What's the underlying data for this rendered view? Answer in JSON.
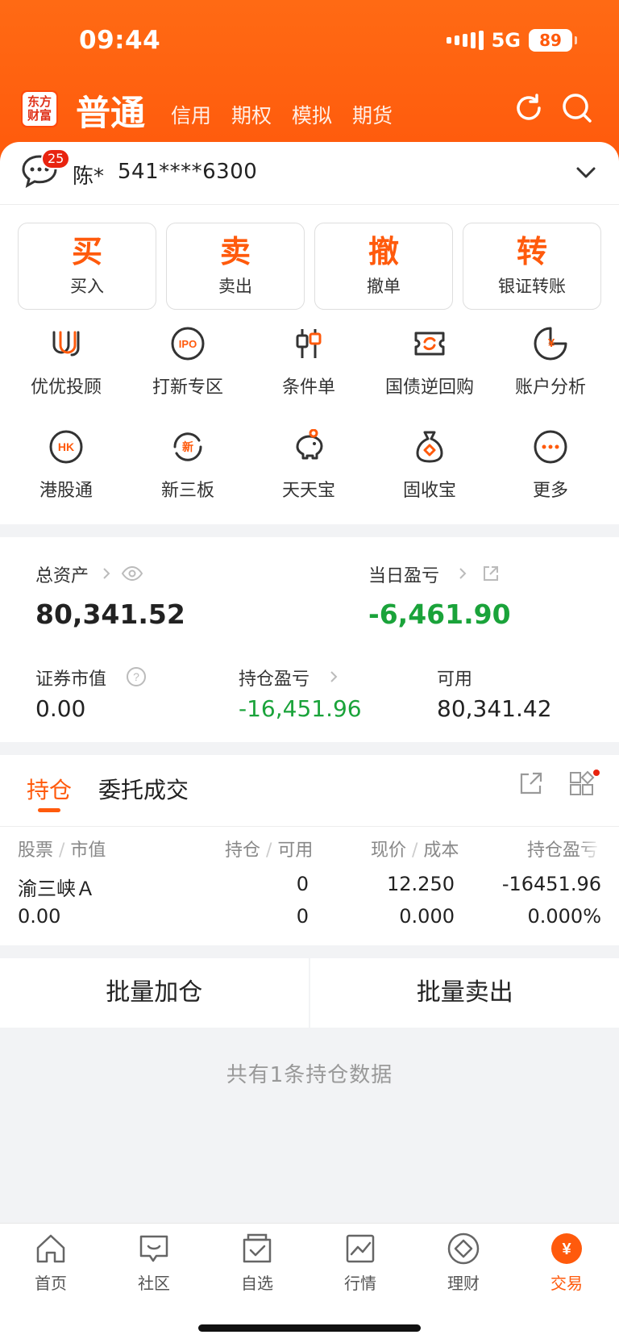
{
  "status": {
    "time": "09:44",
    "network": "5G",
    "battery": "89"
  },
  "header": {
    "logo": [
      "东方",
      "财富"
    ],
    "active_tab": "普通",
    "tabs": [
      "信用",
      "期权",
      "模拟",
      "期货"
    ],
    "icons": [
      "refresh-icon",
      "search-icon"
    ]
  },
  "account": {
    "messages_count": "25",
    "name": "陈*",
    "number": "541****6300"
  },
  "quick_actions": [
    {
      "big": "买",
      "label": "买入"
    },
    {
      "big": "卖",
      "label": "卖出"
    },
    {
      "big": "撤",
      "label": "撤单"
    },
    {
      "big": "转",
      "label": "银证转账"
    }
  ],
  "grid_row1": [
    {
      "label": "优优投顾",
      "icon": "advisor-icon"
    },
    {
      "label": "打新专区",
      "icon": "ipo-icon"
    },
    {
      "label": "条件单",
      "icon": "candlestick-icon"
    },
    {
      "label": "国债逆回购",
      "icon": "bond-repo-icon"
    },
    {
      "label": "账户分析",
      "icon": "account-analysis-icon"
    }
  ],
  "grid_row2": [
    {
      "label": "港股通",
      "icon": "hk-icon"
    },
    {
      "label": "新三板",
      "icon": "new-board-icon"
    },
    {
      "label": "天天宝",
      "icon": "piggy-bank-icon"
    },
    {
      "label": "固收宝",
      "icon": "money-bag-icon"
    },
    {
      "label": "更多",
      "icon": "more-icon"
    }
  ],
  "assets": {
    "total_label": "总资产",
    "total_value": "80,341.52",
    "daily_pl_label": "当日盈亏",
    "daily_pl_value": "-6,461.90",
    "market_value_label": "证券市值",
    "market_value": "0.00",
    "holding_pl_label": "持仓盈亏",
    "holding_pl_value": "-16,451.96",
    "available_label": "可用",
    "available_value": "80,341.42"
  },
  "positions": {
    "tabs": [
      "持仓",
      "委托成交"
    ],
    "headers": [
      "股票",
      "市值",
      "持仓",
      "可用",
      "现价",
      "成本",
      "持仓盈亏"
    ],
    "rows": [
      {
        "name": "渝三峡Ａ",
        "market_value": "0.00",
        "holding": "0",
        "available": "0",
        "price": "12.250",
        "cost": "0.000",
        "pl": "-16451.96",
        "pl_pct": "0.000%"
      }
    ]
  },
  "batch": {
    "add": "批量加仓",
    "sell": "批量卖出"
  },
  "summary": "共有1条持仓数据",
  "nav": [
    {
      "label": "首页",
      "icon": "home-icon"
    },
    {
      "label": "社区",
      "icon": "community-icon"
    },
    {
      "label": "自选",
      "icon": "watchlist-icon"
    },
    {
      "label": "行情",
      "icon": "market-icon"
    },
    {
      "label": "理财",
      "icon": "wealth-icon"
    },
    {
      "label": "交易",
      "icon": "trade-icon"
    }
  ],
  "colors": {
    "accent": "#ff5a0c",
    "loss": "#1aa33a"
  }
}
